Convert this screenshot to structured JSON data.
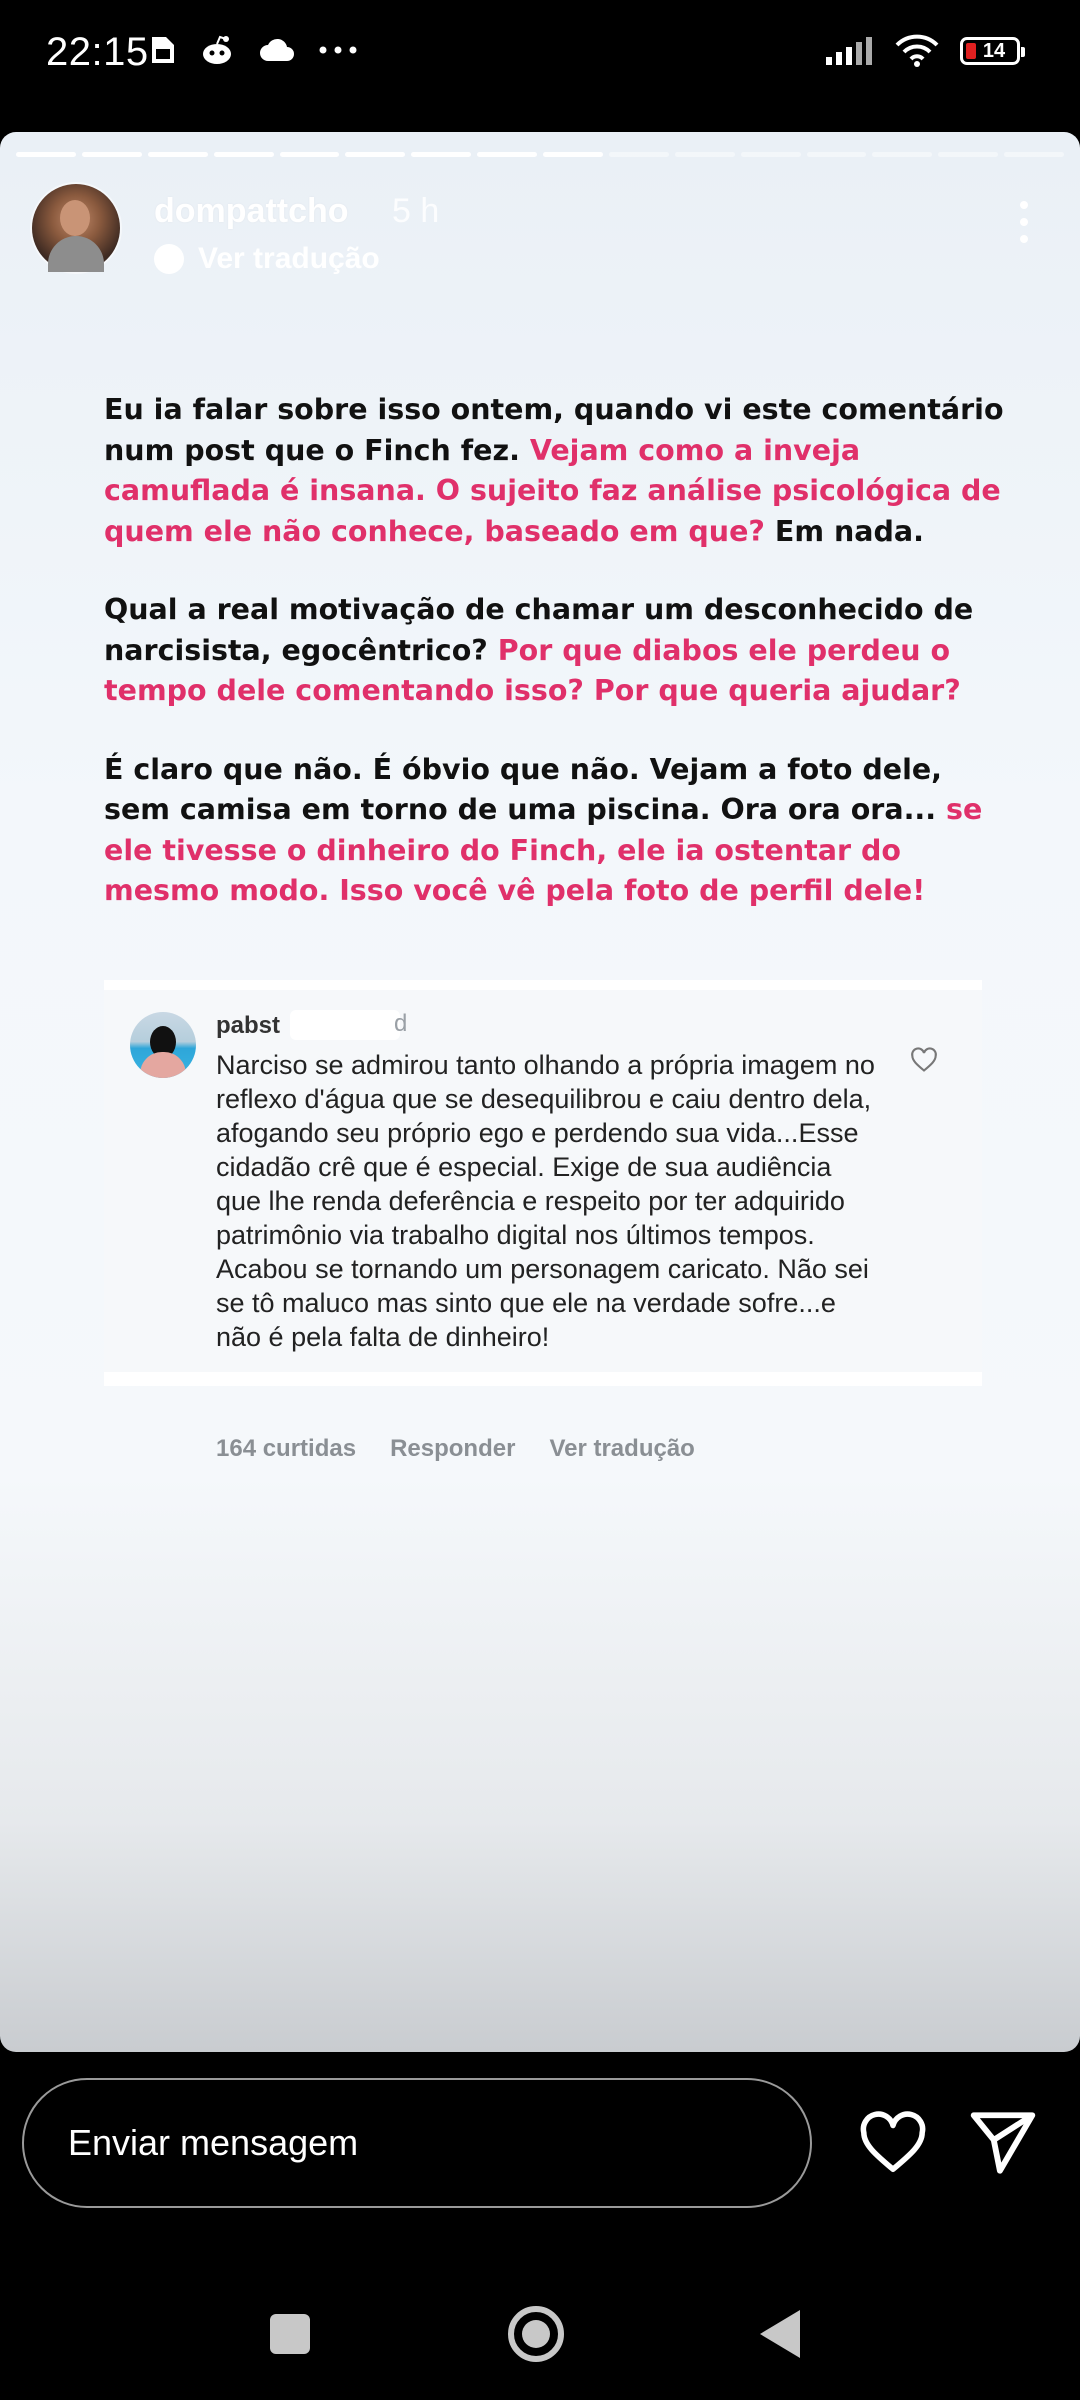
{
  "status_bar": {
    "time": "22:15",
    "battery": "14",
    "icons_left": [
      "sim-card-icon",
      "reddit-icon",
      "cloud-icon",
      "more-dots-icon"
    ],
    "icons_right": [
      "signal-icon",
      "wifi-icon",
      "battery-icon"
    ]
  },
  "story": {
    "progress_total": 16,
    "progress_done": 9,
    "username": "dompattcho",
    "time_ago": "5 h",
    "translate_label": "Ver tradução",
    "paragraphs": [
      [
        {
          "t": "Eu ia falar sobre isso ontem, quando vi este comentário num post que o Finch fez. ",
          "hl": false
        },
        {
          "t": "Vejam como a inveja camuflada é insana. O sujeito faz análise psicológica de quem ele não conhece, baseado em que?",
          "hl": true
        },
        {
          "t": " Em nada.",
          "hl": false
        }
      ],
      [
        {
          "t": "Qual a real motivação de chamar um desconhecido de narcisista, egocêntrico? ",
          "hl": false
        },
        {
          "t": "Por que diabos ele perdeu o tempo dele comentando isso? Por que queria ajudar?",
          "hl": true
        }
      ],
      [
        {
          "t": "É claro que não. É óbvio que não. Vejam a foto dele, sem camisa em torno de uma piscina. Ora ora ora... ",
          "hl": false
        },
        {
          "t": "se ele tivesse o dinheiro do Finch, ele ia ostentar do mesmo modo. Isso você vê pela foto de perfil dele!",
          "hl": true
        }
      ]
    ],
    "highlight_color": "#e0306a"
  },
  "comment": {
    "username_start": "pabst",
    "username_end": "d",
    "text": "Narciso se admirou tanto olhando a própria imagem no reflexo d'água que se desequilibrou e caiu dentro dela, afogando seu próprio ego e perdendo sua vida...Esse cidadão crê que é especial. Exige de sua audiência que lhe renda deferência e respeito por ter adquirido patrimônio via trabalho digital nos últimos tempos. Acabou se tornando um personagem caricato. Não sei se tô maluco mas sinto que ele na verdade sofre...e não é pela falta de dinheiro!",
    "likes": "164 curtidas",
    "reply": "Responder",
    "translate": "Ver tradução"
  },
  "reply_bar": {
    "placeholder": "Enviar mensagem"
  }
}
